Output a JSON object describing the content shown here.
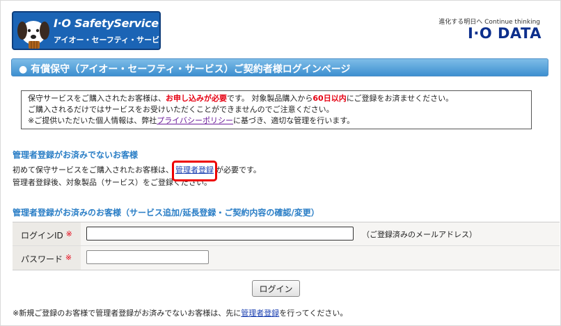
{
  "header": {
    "logo_title": "I·O SafetyService",
    "logo_subtitle": "アイオー・セーフティ・サービス",
    "tagline": "進化する明日へ Continue thinking",
    "brand": "I·O DATA"
  },
  "page_title": "● 有償保守（アイオー・セーフティ・サービス）ご契約者様ログインページ",
  "notice": {
    "line1_prefix": "保守サービスをご購入されたお客様は、",
    "line1_emph1": "お申し込みが必要",
    "line1_mid": "です。 対象製品購入から",
    "line1_emph2": "60日以内",
    "line1_suffix": "にご登録をお済ませください。",
    "line2": "ご購入されるだけではサービスをお受けいただくことができませんのでご注意ください。",
    "line3_prefix": "※ご提供いただいた個人情報は、弊社",
    "line3_link": "プライバシーポリシー",
    "line3_suffix": "に基づき、適切な管理を行います。"
  },
  "section_unregistered": {
    "heading": "管理者登録がお済みでないお客様",
    "line1_prefix": "初めて保守サービスをご購入されたお客様は、",
    "register_link": "管理者登録",
    "line1_suffix": "が必要です。",
    "line2": "管理者登録後、対象製品（サービス）をご登録ください。"
  },
  "section_registered": {
    "heading": "管理者登録がお済みのお客様（サービス追加/延長登録・ご契約内容の確認/変更）"
  },
  "login_form": {
    "id_label": "ログインID",
    "password_label": "パスワード",
    "required_mark": "※",
    "id_value": "",
    "password_value": "",
    "id_hint": "（ご登録済みのメールアドレス）",
    "submit_label": "ログイン"
  },
  "footnote": {
    "prefix": "※新規ご登録のお客様で管理者登録がお済みでないお客様は、先に",
    "link": "管理者登録",
    "suffix": "を行ってください。"
  },
  "colors": {
    "accent_blue": "#2a7ec6",
    "emphasis_red": "#e60012",
    "brand_navy": "#0d2f8c"
  }
}
